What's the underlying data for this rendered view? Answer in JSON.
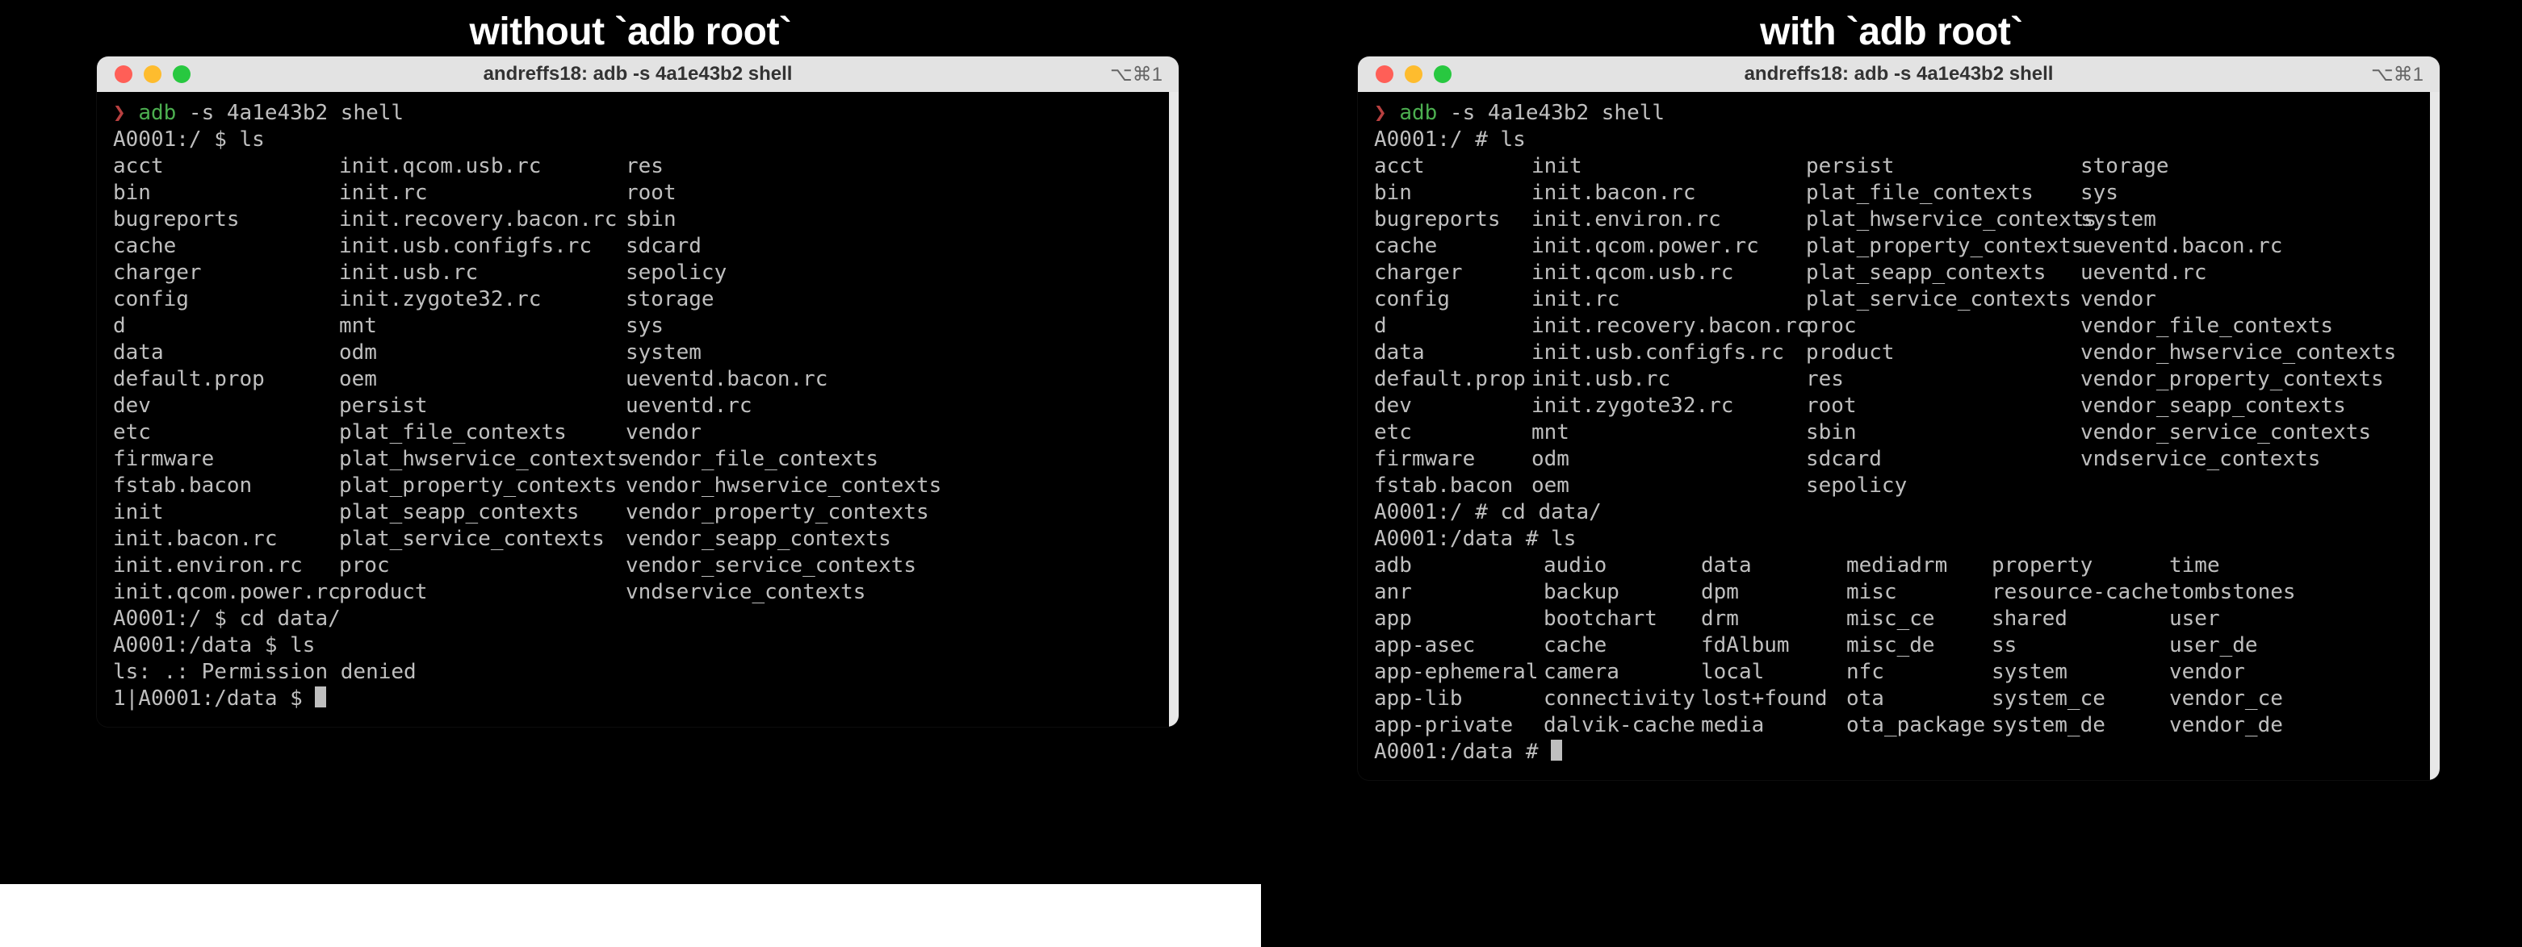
{
  "colors": {
    "traffic_red": "#ff5f57",
    "traffic_yellow": "#febc2e",
    "traffic_green": "#28c840"
  },
  "left": {
    "caption": "without `adb root`",
    "titlebar": {
      "title": "andreffs18: adb -s 4a1e43b2 shell",
      "meta": "⌥⌘1"
    },
    "lines": {
      "cmd1_caret": "❯",
      "cmd1_cmd": "adb",
      "cmd1_args": " -s 4a1e43b2 shell",
      "p1": "A0001:/ $ ls",
      "p2": "A0001:/ $ cd data/",
      "p3": "A0001:/data $ ls",
      "err": "ls: .: Permission denied",
      "p4": "1|A0001:/data $ "
    },
    "ls_root": [
      [
        "acct",
        "init.qcom.usb.rc",
        "res"
      ],
      [
        "bin",
        "init.rc",
        "root"
      ],
      [
        "bugreports",
        "init.recovery.bacon.rc",
        "sbin"
      ],
      [
        "cache",
        "init.usb.configfs.rc",
        "sdcard"
      ],
      [
        "charger",
        "init.usb.rc",
        "sepolicy"
      ],
      [
        "config",
        "init.zygote32.rc",
        "storage"
      ],
      [
        "d",
        "mnt",
        "sys"
      ],
      [
        "data",
        "odm",
        "system"
      ],
      [
        "default.prop",
        "oem",
        "ueventd.bacon.rc"
      ],
      [
        "dev",
        "persist",
        "ueventd.rc"
      ],
      [
        "etc",
        "plat_file_contexts",
        "vendor"
      ],
      [
        "firmware",
        "plat_hwservice_contexts",
        "vendor_file_contexts"
      ],
      [
        "fstab.bacon",
        "plat_property_contexts",
        "vendor_hwservice_contexts"
      ],
      [
        "init",
        "plat_seapp_contexts",
        "vendor_property_contexts"
      ],
      [
        "init.bacon.rc",
        "plat_service_contexts",
        "vendor_seapp_contexts"
      ],
      [
        "init.environ.rc",
        "proc",
        "vendor_service_contexts"
      ],
      [
        "init.qcom.power.rc",
        "product",
        "vndservice_contexts"
      ]
    ]
  },
  "right": {
    "caption": "with `adb root`",
    "titlebar": {
      "title": "andreffs18: adb -s 4a1e43b2 shell",
      "meta": "⌥⌘1"
    },
    "lines": {
      "cmd1_caret": "❯",
      "cmd1_cmd": "adb",
      "cmd1_args": " -s 4a1e43b2 shell",
      "p1": "A0001:/ # ls",
      "p2": "A0001:/ # cd data/",
      "p3": "A0001:/data # ls",
      "p4": "A0001:/data # "
    },
    "ls_root": [
      [
        "acct",
        "init",
        "persist",
        "storage"
      ],
      [
        "bin",
        "init.bacon.rc",
        "plat_file_contexts",
        "sys"
      ],
      [
        "bugreports",
        "init.environ.rc",
        "plat_hwservice_contexts",
        "system"
      ],
      [
        "cache",
        "init.qcom.power.rc",
        "plat_property_contexts",
        "ueventd.bacon.rc"
      ],
      [
        "charger",
        "init.qcom.usb.rc",
        "plat_seapp_contexts",
        "ueventd.rc"
      ],
      [
        "config",
        "init.rc",
        "plat_service_contexts",
        "vendor"
      ],
      [
        "d",
        "init.recovery.bacon.rc",
        "proc",
        "vendor_file_contexts"
      ],
      [
        "data",
        "init.usb.configfs.rc",
        "product",
        "vendor_hwservice_contexts"
      ],
      [
        "default.prop",
        "init.usb.rc",
        "res",
        "vendor_property_contexts"
      ],
      [
        "dev",
        "init.zygote32.rc",
        "root",
        "vendor_seapp_contexts"
      ],
      [
        "etc",
        "mnt",
        "sbin",
        "vendor_service_contexts"
      ],
      [
        "firmware",
        "odm",
        "sdcard",
        "vndservice_contexts"
      ],
      [
        "fstab.bacon",
        "oem",
        "sepolicy",
        ""
      ]
    ],
    "ls_data": [
      [
        "adb",
        "audio",
        "data",
        "mediadrm",
        "property",
        "time"
      ],
      [
        "anr",
        "backup",
        "dpm",
        "misc",
        "resource-cache",
        "tombstones"
      ],
      [
        "app",
        "bootchart",
        "drm",
        "misc_ce",
        "shared",
        "user"
      ],
      [
        "app-asec",
        "cache",
        "fdAlbum",
        "misc_de",
        "ss",
        "user_de"
      ],
      [
        "app-ephemeral",
        "camera",
        "local",
        "nfc",
        "system",
        "vendor"
      ],
      [
        "app-lib",
        "connectivity",
        "lost+found",
        "ota",
        "system_ce",
        "vendor_ce"
      ],
      [
        "app-private",
        "dalvik-cache",
        "media",
        "ota_package",
        "system_de",
        "vendor_de"
      ]
    ]
  }
}
